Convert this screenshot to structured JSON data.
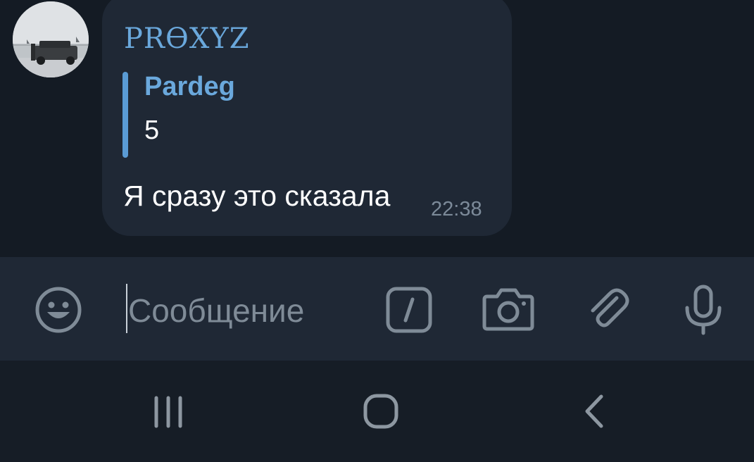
{
  "message": {
    "sender_name": "PRӨXYZ",
    "reply": {
      "name": "Pardeg",
      "text": "5"
    },
    "text": "Я сразу это сказала",
    "time": "22:38"
  },
  "composer": {
    "placeholder": "Сообщение",
    "icons": [
      "emoji-icon",
      "bot-command-icon",
      "camera-icon",
      "attach-icon",
      "microphone-icon"
    ]
  },
  "navigation": {
    "icons": [
      "recent-apps-icon",
      "home-icon",
      "back-icon"
    ]
  },
  "colors": {
    "background": "#141b24",
    "bubble": "#1f2835",
    "accent": "#6aa8dc",
    "muted": "#7c8a99"
  }
}
